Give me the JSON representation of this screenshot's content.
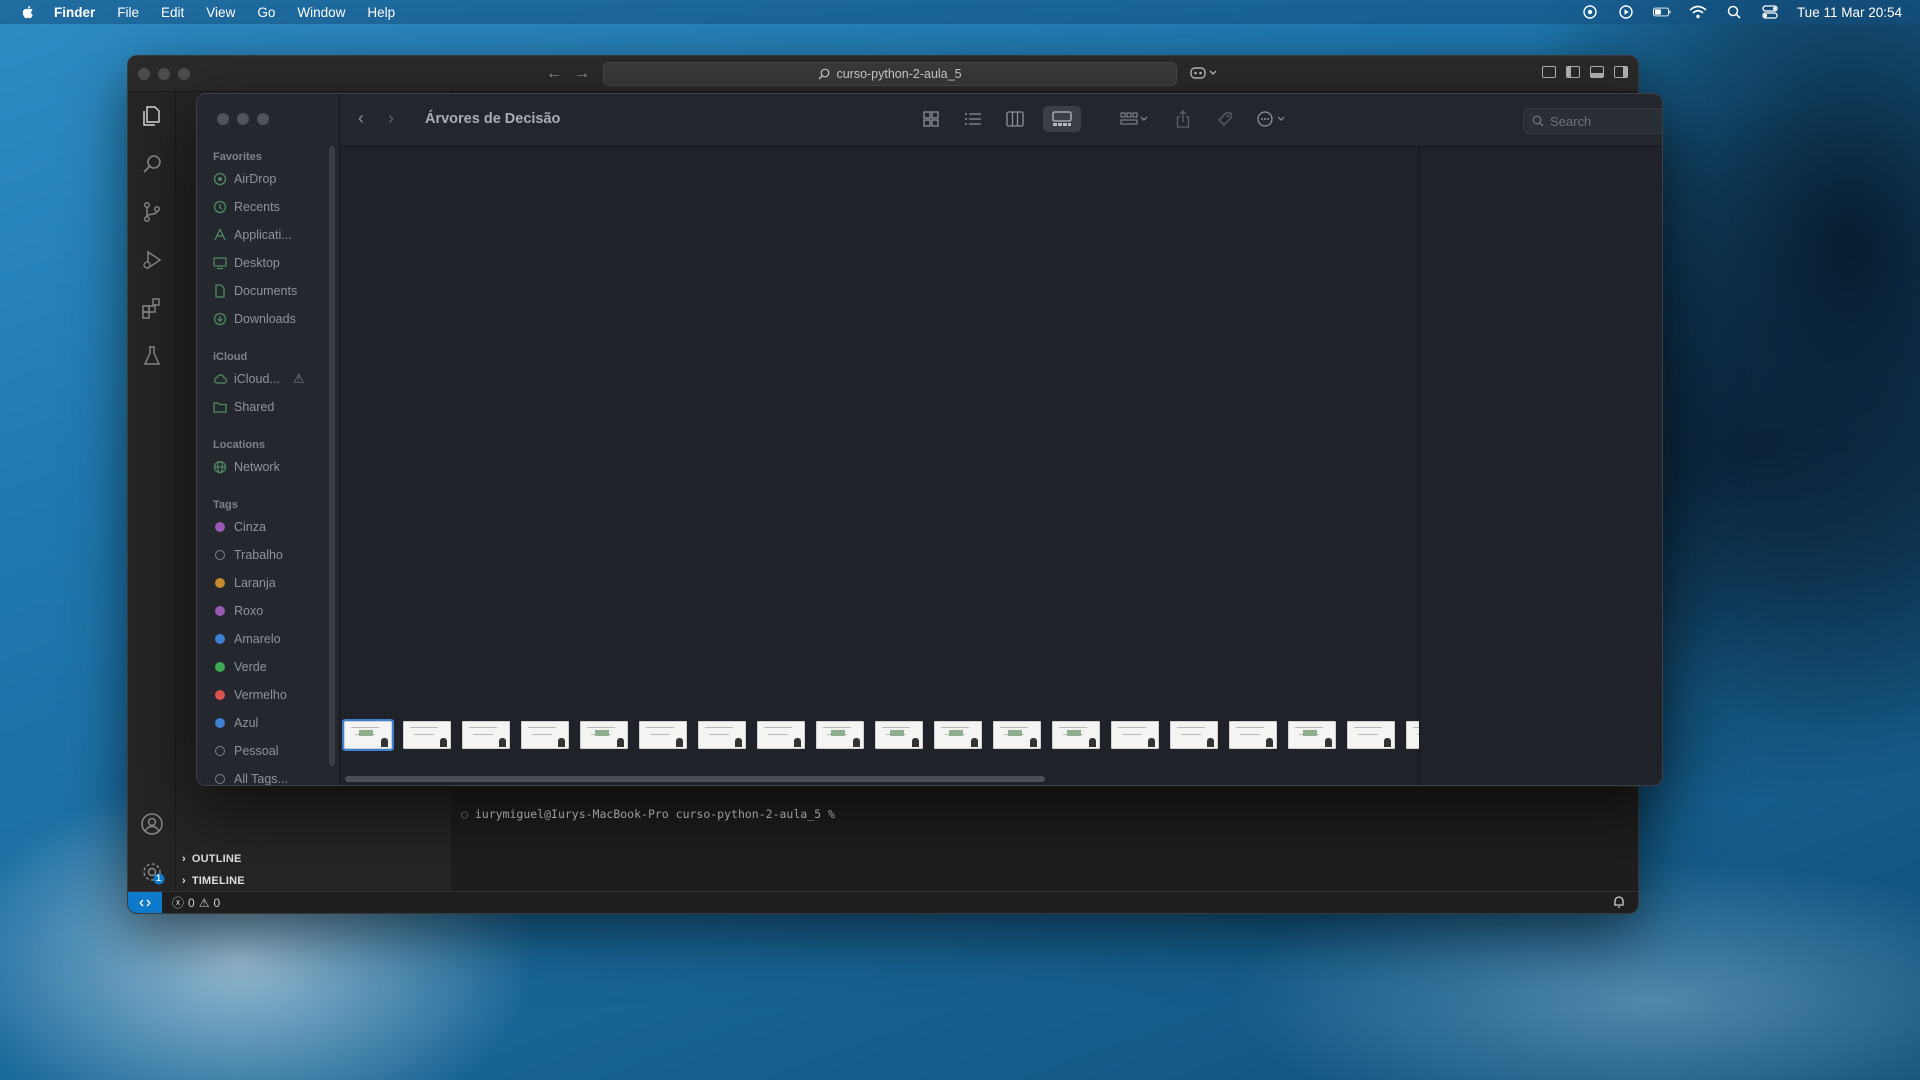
{
  "menubar": {
    "app": "Finder",
    "items": [
      "File",
      "Edit",
      "View",
      "Go",
      "Window",
      "Help"
    ],
    "datetime": "Tue 11 Mar  20:54"
  },
  "vscode": {
    "command_center": "curso-python-2-aula_5",
    "outline_label": "OUTLINE",
    "timeline_label": "TIMELINE",
    "terminal_prompt": "iurymiguel@Iurys-MacBook-Pro curso-python-2-aula_5 %",
    "errors": "0",
    "warnings": "0",
    "settings_badge": "1",
    "accent": "#0e7acc"
  },
  "finder": {
    "title": "Árvores de Decisão",
    "search_placeholder": "Search",
    "sidebar": {
      "favorites_heading": "Favorites",
      "favorites": [
        {
          "label": "AirDrop",
          "icon": "airdrop-icon"
        },
        {
          "label": "Recents",
          "icon": "clock-icon"
        },
        {
          "label": "Applicati...",
          "icon": "applications-icon"
        },
        {
          "label": "Desktop",
          "icon": "desktop-icon"
        },
        {
          "label": "Documents",
          "icon": "document-icon"
        },
        {
          "label": "Downloads",
          "icon": "download-icon"
        }
      ],
      "icloud_heading": "iCloud",
      "icloud": [
        {
          "label": "iCloud...",
          "icon": "cloud-icon"
        },
        {
          "label": "Shared",
          "icon": "shared-folder-icon"
        }
      ],
      "locations_heading": "Locations",
      "locations": [
        {
          "label": "Network",
          "icon": "globe-icon"
        }
      ],
      "tags_heading": "Tags",
      "tags": [
        {
          "label": "Cinza",
          "color": "#9b59b6"
        },
        {
          "label": "Trabalho",
          "color": "transparent"
        },
        {
          "label": "Laranja",
          "color": "#c58a2e"
        },
        {
          "label": "Roxo",
          "color": "#9b59b6"
        },
        {
          "label": "Amarelo",
          "color": "#3d7fd1"
        },
        {
          "label": "Verde",
          "color": "#3faa55"
        },
        {
          "label": "Vermelho",
          "color": "#d9534f"
        },
        {
          "label": "Azul",
          "color": "#3d7fd1"
        },
        {
          "label": "Pessoal",
          "color": "transparent"
        },
        {
          "label": "All Tags...",
          "color": "transparent"
        }
      ]
    },
    "thumbnail_count": 19
  }
}
